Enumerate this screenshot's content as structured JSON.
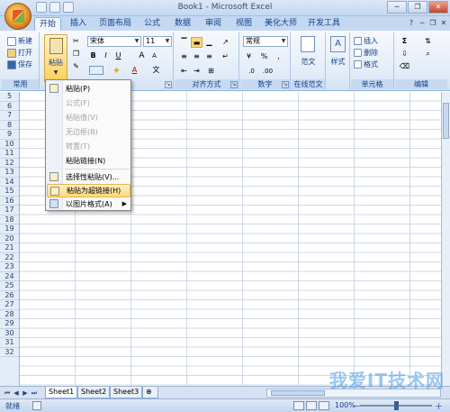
{
  "window": {
    "title": "Book1 - Microsoft Excel",
    "controls": [
      "─",
      "❐",
      "✕"
    ]
  },
  "tabs": [
    "开始",
    "插入",
    "页面布局",
    "公式",
    "数据",
    "审阅",
    "视图",
    "美化大师",
    "开发工具"
  ],
  "ribbon": {
    "common": {
      "new": "新建",
      "open": "打开",
      "save": "保存",
      "label": "常用"
    },
    "clipboard": {
      "paste": "粘贴"
    },
    "font": {
      "name": "宋体",
      "size": "11",
      "bold": "B",
      "italic": "I",
      "underline": "U",
      "grow": "A",
      "shrink": "A",
      "color_letter": "A",
      "phonetic": "文"
    },
    "alignment": {
      "label": "对齐方式"
    },
    "number": {
      "format": "常规",
      "percent": "%",
      "comma": ",",
      "label": "数字"
    },
    "template": {
      "label": "范文",
      "group_label": "在线范文"
    },
    "styles": {
      "label": "样式"
    },
    "cells": {
      "insert": "插入",
      "delete": "删除",
      "format": "格式",
      "label": "单元格"
    },
    "editing": {
      "sigma": "Σ",
      "label": "编辑"
    }
  },
  "paste_menu": {
    "items": [
      {
        "label": "粘贴(P)",
        "enabled": true
      },
      {
        "label": "公式(F)",
        "enabled": false
      },
      {
        "label": "粘贴值(V)",
        "enabled": false
      },
      {
        "label": "无边框(B)",
        "enabled": false
      },
      {
        "label": "转置(T)",
        "enabled": false
      },
      {
        "label": "粘贴链接(N)",
        "enabled": true
      },
      {
        "label": "选择性粘贴(V)...",
        "enabled": true
      },
      {
        "label": "粘贴为超链接(H)",
        "enabled": true,
        "highlighted": true
      },
      {
        "label": "以图片格式(A)",
        "enabled": true,
        "submenu": true
      }
    ]
  },
  "rows": [
    "5",
    "6",
    "7",
    "8",
    "9",
    "10",
    "11",
    "12",
    "13",
    "14",
    "15",
    "16",
    "17",
    "18",
    "19",
    "20",
    "21",
    "22",
    "23",
    "24",
    "25",
    "26",
    "27",
    "28",
    "29",
    "30",
    "31",
    "32"
  ],
  "sheets": [
    "Sheet1",
    "Sheet2",
    "Sheet3"
  ],
  "status": {
    "ready": "就绪",
    "zoom": "100%",
    "minus": "－",
    "plus": "＋"
  },
  "watermark": "我爱IT技术网",
  "colors": {
    "accent": "#15428b",
    "ribbon_bg": "#e3ecf8",
    "highlight": "#ffd778"
  }
}
